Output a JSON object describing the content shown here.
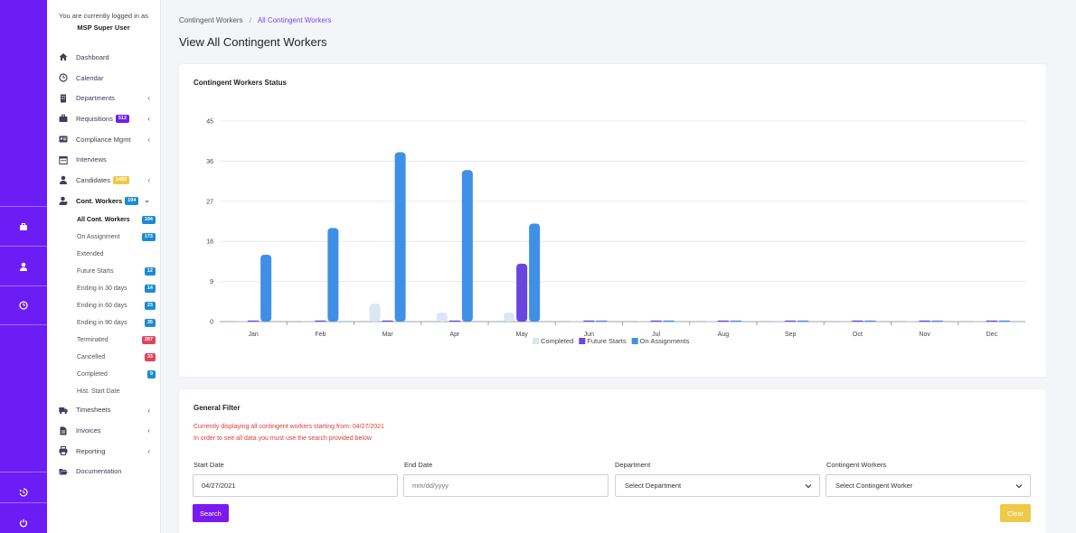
{
  "user": {
    "login_text": "You are currently logged in as",
    "name": "MSP Super User"
  },
  "rail_icons": [
    "briefcase-icon",
    "user-tie-icon",
    "clock-icon",
    "history-icon",
    "power-icon"
  ],
  "nav": {
    "dashboard": "Dashboard",
    "calendar": "Calendar",
    "departments": "Departments",
    "requisitions": "Requisitions",
    "requisitions_badge": "512",
    "compliance": "Compliance Mgmt",
    "interviews": "Interviews",
    "candidates": "Candidates",
    "candidates_badge": "1492",
    "cont_workers": "Cont. Workers",
    "cont_workers_badge": "194",
    "sub": [
      {
        "label": "All Cont. Workers",
        "badge": "194"
      },
      {
        "label": "On Assignment",
        "badge": "173"
      },
      {
        "label": "Extended",
        "badge": ""
      },
      {
        "label": "Future Starts",
        "badge": "12"
      },
      {
        "label": "Ending in 30 days",
        "badge": "14"
      },
      {
        "label": "Ending in 60 days",
        "badge": "23"
      },
      {
        "label": "Ending in 90 days",
        "badge": "35"
      },
      {
        "label": "Terminated",
        "badge": "287"
      },
      {
        "label": "Cancelled",
        "badge": "33"
      },
      {
        "label": "Completed",
        "badge": "9"
      },
      {
        "label": "Hist. Start Date",
        "badge": ""
      }
    ],
    "timesheets": "Timesheets",
    "invoices": "Invoices",
    "reporting": "Reporting",
    "documentation": "Documentation"
  },
  "breadcrumb": {
    "parent": "Contingent Workers",
    "separator": "/",
    "current": "All Contingent Workers"
  },
  "page_title": "View All Contingent Workers",
  "chart_card_title": "Contingent Workers Status",
  "chart_data": {
    "type": "bar",
    "title": "Contingent Workers Status",
    "categories": [
      "Jan",
      "Feb",
      "Mar",
      "Apr",
      "May",
      "Jun",
      "Jul",
      "Aug",
      "Sep",
      "Oct",
      "Nov",
      "Dec"
    ],
    "yticks": [
      "0",
      "9",
      "18",
      "27",
      "36",
      "45"
    ],
    "ylim": [
      0,
      45
    ],
    "grid": true,
    "legend": "bottom",
    "series": [
      {
        "name": "Completed",
        "color": "#dbe7f5",
        "values": [
          0,
          0,
          4,
          2,
          2,
          0,
          0,
          0,
          0,
          0,
          0,
          0
        ]
      },
      {
        "name": "Future Starts",
        "color": "#6a45e0",
        "values": [
          0,
          0,
          0,
          0,
          13,
          0,
          0,
          0,
          0,
          0,
          0,
          0
        ]
      },
      {
        "name": "On Assignments",
        "color": "#3f8fe6",
        "values": [
          15,
          21,
          38,
          34,
          22,
          0,
          0,
          0,
          0,
          0,
          0,
          0
        ]
      }
    ]
  },
  "filter": {
    "title": "General Filter",
    "warning_line1": "Currently displaying all contingent workers starting from: 04/27/2021",
    "warning_line2": "In order to see all data you must use the search provided below",
    "start_label": "Start Date",
    "start_value": "04/27/2021",
    "end_label": "End Date",
    "end_placeholder": "mm/dd/yyyy",
    "department_label": "Department",
    "department_value": "Select Department",
    "workers_label": "Contingent Workers",
    "workers_value": "Select Contingent Worker",
    "search_label": "Search",
    "clear_label": "Clear"
  }
}
